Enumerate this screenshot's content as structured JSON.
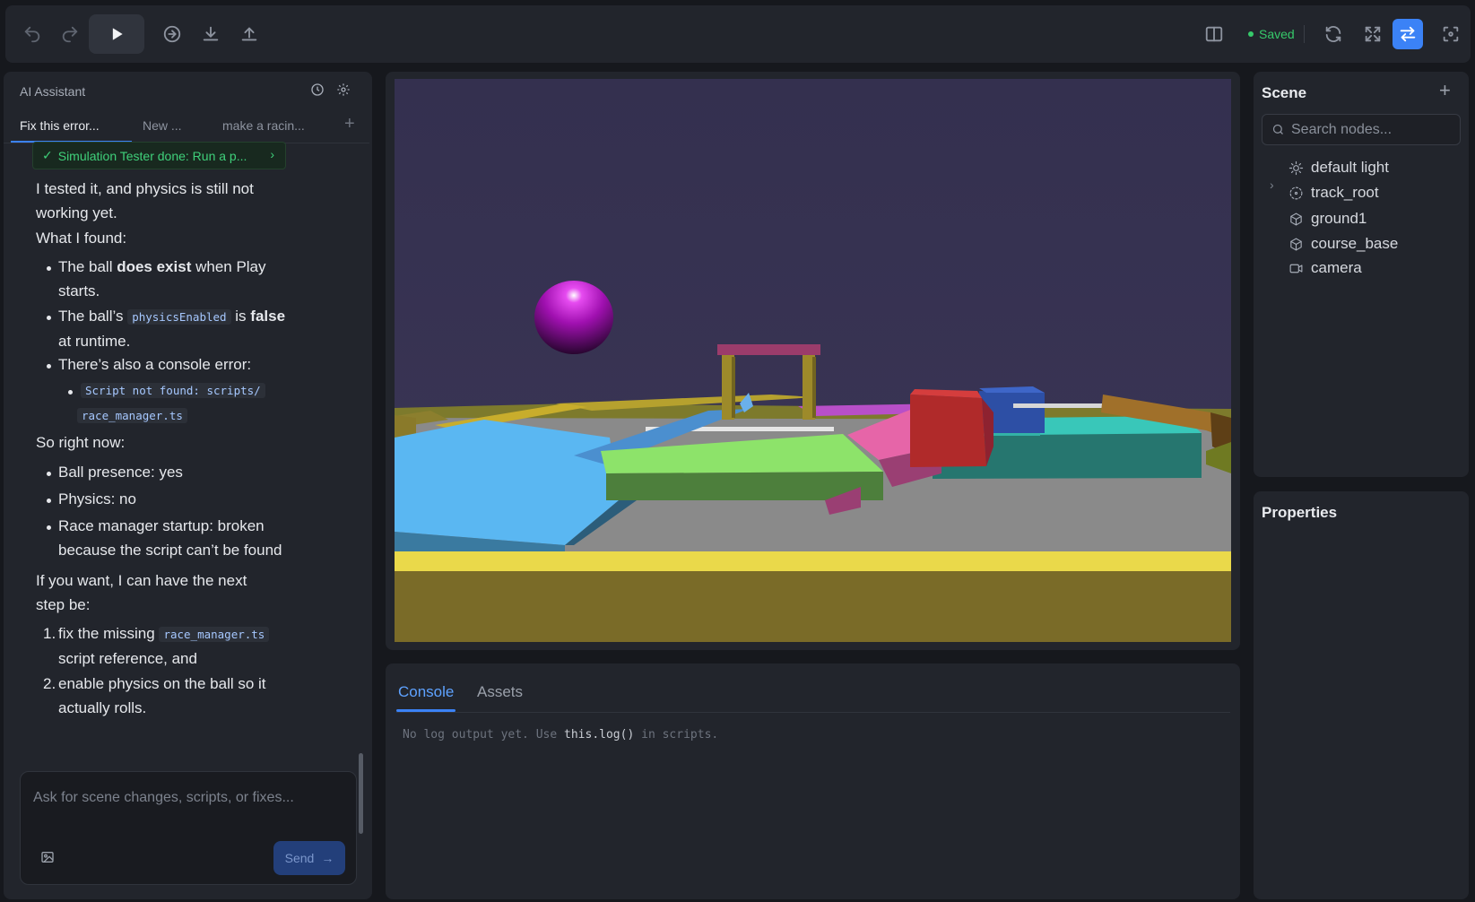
{
  "toolbar": {
    "saved_label": "Saved",
    "accent": "#3b82f6",
    "saved_color": "#36c96a"
  },
  "ai_panel": {
    "title": "AI Assistant",
    "tabs": [
      "Fix this error...",
      "New ...",
      "make a racin..."
    ],
    "status_text": "Simulation Tester done: Run a p...",
    "messages": {
      "intro": "I tested it, and physics is still not working yet.",
      "found_heading": "What I found:",
      "b1_pre": "The ball ",
      "b1_bold": "does exist",
      "b1_post": " when Play starts.",
      "b2_pre": "The ball’s ",
      "b2_code": "physicsEnabled",
      "b2_mid": " is ",
      "b2_bold": "false",
      "b2_post": "at runtime.",
      "b3": "There’s also a console error:",
      "b3_code_line1": "Script not found: scripts/",
      "b3_code_line2": "race_manager.ts",
      "summary_heading": "So right now:",
      "s1": "Ball presence: yes",
      "s2": "Physics: no",
      "s3": "Race manager startup: broken because the script can’t be found",
      "next_heading": "If you want, I can have the next step be:",
      "n1_pre": "fix the missing ",
      "n1_code": "race_manager.ts",
      "n1_post": "script reference, and",
      "n2": "enable physics on the ball so it actually rolls.",
      "n1_num": "1.",
      "n2_num": "2."
    },
    "composer": {
      "placeholder": "Ask for scene changes, scripts, or fixes...",
      "send_label": "Send"
    }
  },
  "console": {
    "tabs": [
      "Console",
      "Assets"
    ],
    "log_pre": "No log output yet. Use ",
    "log_code": "this.log()",
    "log_post": " in scripts."
  },
  "scene": {
    "title": "Scene",
    "search_placeholder": "Search nodes...",
    "nodes": [
      {
        "label": "default light",
        "icon": "sun-icon"
      },
      {
        "label": "track_root",
        "icon": "group-icon"
      },
      {
        "label": "ground1",
        "icon": "cube-icon"
      },
      {
        "label": "course_base",
        "icon": "cube-icon"
      },
      {
        "label": "camera",
        "icon": "camera-icon"
      }
    ]
  },
  "properties": {
    "title": "Properties"
  }
}
